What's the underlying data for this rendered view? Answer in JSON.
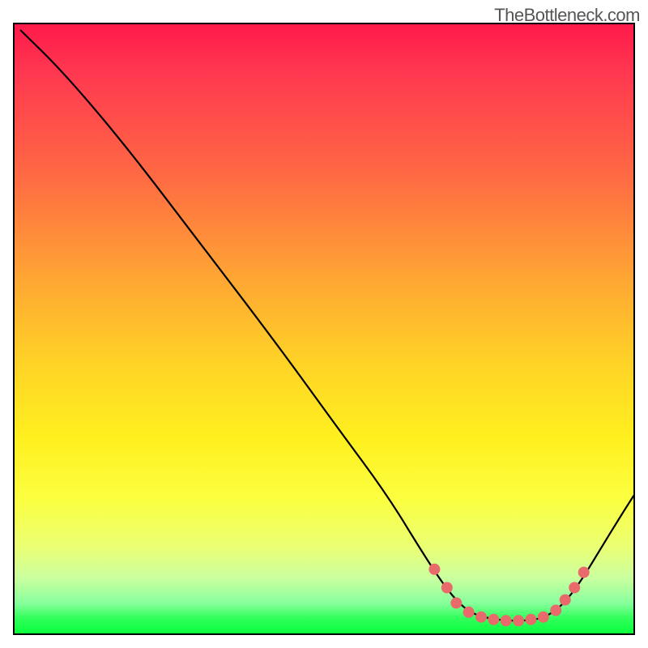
{
  "watermark": "TheBottleneck.com",
  "chart_data": {
    "type": "line",
    "title": "",
    "xlabel": "",
    "ylabel": "",
    "xlim": [
      0,
      100
    ],
    "ylim": [
      0,
      100
    ],
    "curve": [
      {
        "x": 1,
        "y": 99
      },
      {
        "x": 8,
        "y": 92
      },
      {
        "x": 18,
        "y": 80
      },
      {
        "x": 30,
        "y": 64
      },
      {
        "x": 42,
        "y": 48
      },
      {
        "x": 52,
        "y": 34
      },
      {
        "x": 60,
        "y": 23
      },
      {
        "x": 66,
        "y": 13
      },
      {
        "x": 70,
        "y": 7
      },
      {
        "x": 73,
        "y": 4
      },
      {
        "x": 76,
        "y": 3
      },
      {
        "x": 79,
        "y": 2.6
      },
      {
        "x": 82,
        "y": 2.6
      },
      {
        "x": 85,
        "y": 3
      },
      {
        "x": 88,
        "y": 5
      },
      {
        "x": 91,
        "y": 9
      },
      {
        "x": 94,
        "y": 14
      },
      {
        "x": 97,
        "y": 19
      },
      {
        "x": 99.5,
        "y": 23
      }
    ],
    "highlight_dots": [
      {
        "x": 67.5,
        "y": 11
      },
      {
        "x": 69.5,
        "y": 8
      },
      {
        "x": 71.0,
        "y": 5.5
      },
      {
        "x": 73.0,
        "y": 4.0
      },
      {
        "x": 75.0,
        "y": 3.2
      },
      {
        "x": 77.0,
        "y": 2.8
      },
      {
        "x": 79.0,
        "y": 2.6
      },
      {
        "x": 81.0,
        "y": 2.6
      },
      {
        "x": 83.0,
        "y": 2.8
      },
      {
        "x": 85.0,
        "y": 3.2
      },
      {
        "x": 87.0,
        "y": 4.3
      },
      {
        "x": 88.5,
        "y": 6.0
      },
      {
        "x": 90.0,
        "y": 8.0
      },
      {
        "x": 91.5,
        "y": 10.5
      }
    ],
    "gradient_stops_percent": [
      {
        "pos": 0,
        "color": "#ff1a4b"
      },
      {
        "pos": 25,
        "color": "#ff6a43"
      },
      {
        "pos": 56,
        "color": "#ffd426"
      },
      {
        "pos": 78,
        "color": "#fbff40"
      },
      {
        "pos": 95,
        "color": "#88ff9d"
      },
      {
        "pos": 100,
        "color": "#0bff3e"
      }
    ]
  }
}
